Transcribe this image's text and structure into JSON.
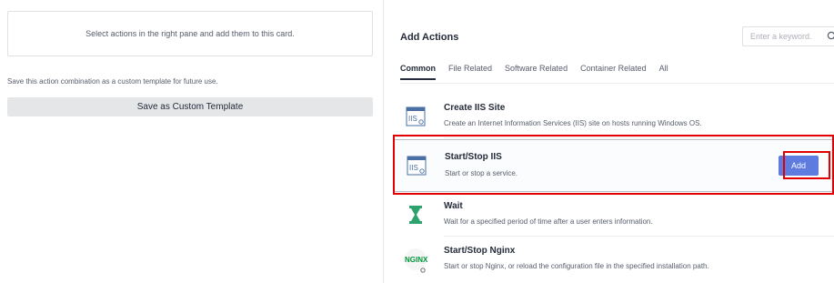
{
  "left_panel": {
    "card_hint": "Select actions in the right pane and add them to this card.",
    "save_hint": "Save this action combination as a custom template for future use.",
    "save_button": "Save as Custom Template"
  },
  "right_panel": {
    "title": "Add Actions",
    "search": {
      "placeholder": "Enter a keyword.",
      "icon": "search-icon"
    },
    "tabs": [
      {
        "label": "Common",
        "active": true
      },
      {
        "label": "File Related",
        "active": false
      },
      {
        "label": "Software Related",
        "active": false
      },
      {
        "label": "Container Related",
        "active": false
      },
      {
        "label": "All",
        "active": false
      }
    ],
    "actions": [
      {
        "name": "Create IIS Site",
        "description": "Create an Internet Information Services (IIS) site on hosts running Windows OS.",
        "icon": "iis-icon"
      },
      {
        "name": "Start/Stop IIS",
        "description": "Start or stop a service.",
        "icon": "iis-icon",
        "selected": true,
        "button": "Add"
      },
      {
        "name": "Wait",
        "description": "Wait for a specified period of time after a user enters information.",
        "icon": "hourglass-icon"
      },
      {
        "name": "Start/Stop Nginx",
        "description": "Start or stop Nginx, or reload the configuration file in the specified installation path.",
        "icon": "nginx-icon",
        "icon_text": "NGINX"
      }
    ]
  },
  "colors": {
    "accent": "#5e7ce0",
    "highlight": "#e20000",
    "wait_icon": "#2ea36d",
    "nginx_icon": "#009639"
  }
}
